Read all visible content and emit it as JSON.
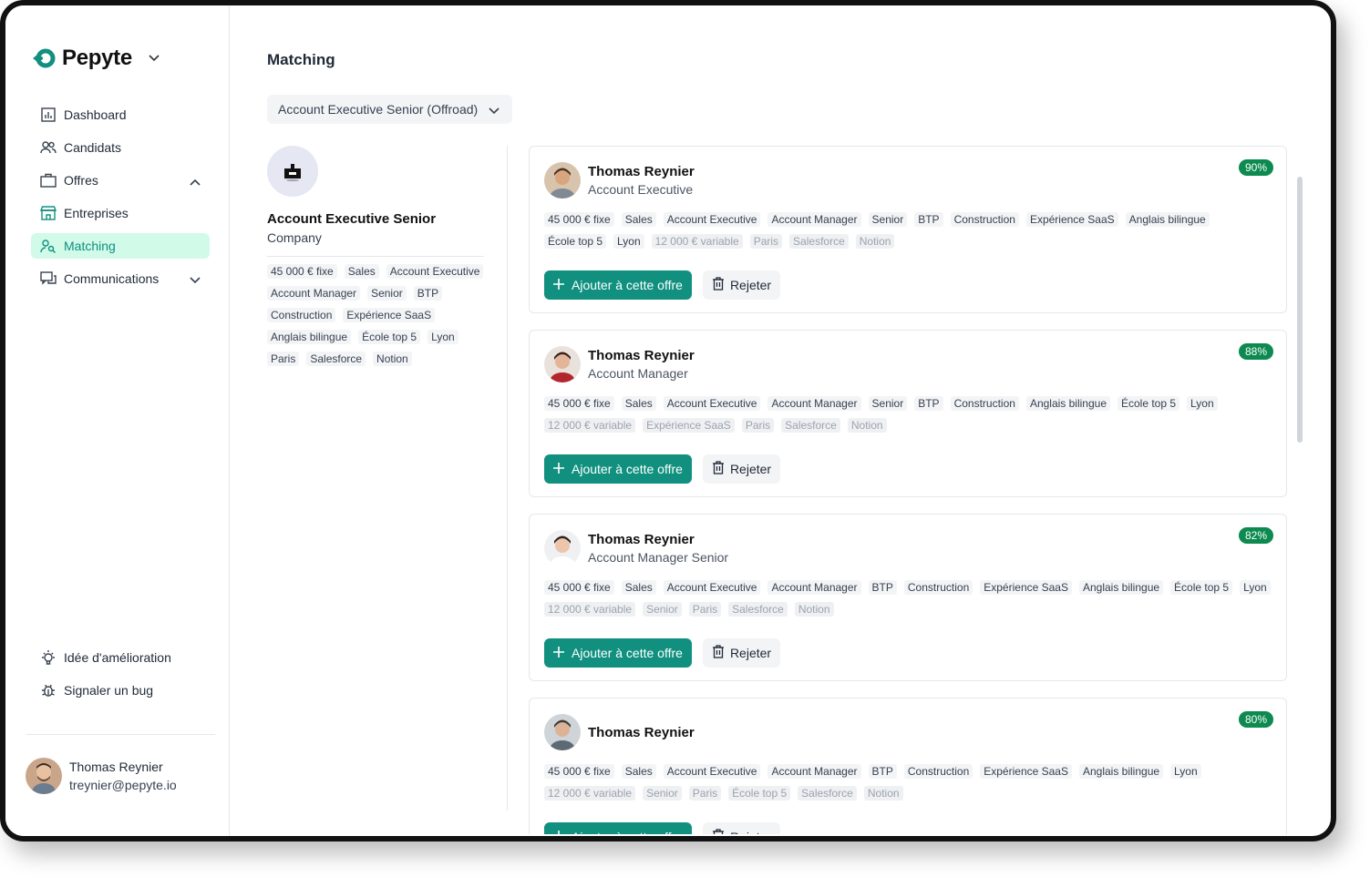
{
  "app": {
    "brand": "Pepyte",
    "brand_color": "#11907f"
  },
  "sidebar": {
    "items": [
      {
        "label": "Dashboard",
        "icon": "dashboard-icon"
      },
      {
        "label": "Candidats",
        "icon": "users-icon"
      },
      {
        "label": "Offres",
        "icon": "briefcase-icon",
        "chevron": "up"
      },
      {
        "label": "Entreprises",
        "icon": "store-icon"
      },
      {
        "label": "Matching",
        "icon": "user-search-icon",
        "active": true
      },
      {
        "label": "Communications",
        "icon": "chat-icon",
        "chevron": "down"
      }
    ],
    "bottom": [
      {
        "label": "Idée d'amélioration",
        "icon": "lightbulb-icon"
      },
      {
        "label": "Signaler un bug",
        "icon": "bug-icon"
      }
    ],
    "user": {
      "name": "Thomas Reynier",
      "email": "treynier@pepyte.io"
    }
  },
  "main": {
    "title": "Matching",
    "offer_select": {
      "value": "Account Executive Senior (Offroad)"
    },
    "offer": {
      "title": "Account Executive Senior",
      "company": "Company",
      "tags": [
        "45 000 € fixe",
        "Sales",
        "Account Executive",
        "Account Manager",
        "Senior",
        "BTP",
        "Construction",
        "Expérience SaaS",
        "Anglais bilingue",
        "École top 5",
        "Lyon",
        "Paris",
        "Salesforce",
        "Notion"
      ]
    },
    "actions": {
      "add_label": "Ajouter à cette offre",
      "reject_label": "Rejeter"
    },
    "candidates": [
      {
        "name": "Thomas Reynier",
        "role": "Account Executive",
        "score": "90%",
        "tags": [
          "45 000 € fixe",
          "Sales",
          "Account Executive",
          "Account Manager",
          "Senior",
          "BTP",
          "Construction",
          "Expérience SaaS",
          "Anglais bilingue",
          "École top 5",
          "Lyon"
        ],
        "dim_tags": [
          "12 000 € variable",
          "Paris",
          "Salesforce",
          "Notion"
        ]
      },
      {
        "name": "Thomas Reynier",
        "role": "Account Manager",
        "score": "88%",
        "tags": [
          "45 000 € fixe",
          "Sales",
          "Account Executive",
          "Account Manager",
          "Senior",
          "BTP",
          "Construction",
          "Anglais bilingue",
          "École top 5",
          "Lyon"
        ],
        "dim_tags": [
          "12 000 € variable",
          "Expérience SaaS",
          "Paris",
          "Salesforce",
          "Notion"
        ]
      },
      {
        "name": "Thomas Reynier",
        "role": "Account Manager Senior",
        "score": "82%",
        "tags": [
          "45 000 € fixe",
          "Sales",
          "Account Executive",
          "Account Manager",
          "BTP",
          "Construction",
          "Expérience SaaS",
          "Anglais bilingue",
          "École top 5",
          "Lyon"
        ],
        "dim_tags": [
          "12 000 € variable",
          "Senior",
          "Paris",
          "Salesforce",
          "Notion"
        ]
      },
      {
        "name": "Thomas Reynier",
        "role": "",
        "score": "80%",
        "tags": [
          "45 000 € fixe",
          "Sales",
          "Account Executive",
          "Account Manager",
          "BTP",
          "Construction",
          "Expérience SaaS",
          "Anglais bilingue",
          "Lyon"
        ],
        "dim_tags": [
          "12 000 € variable",
          "Senior",
          "Paris",
          "École top 5",
          "Salesforce",
          "Notion"
        ]
      }
    ]
  }
}
